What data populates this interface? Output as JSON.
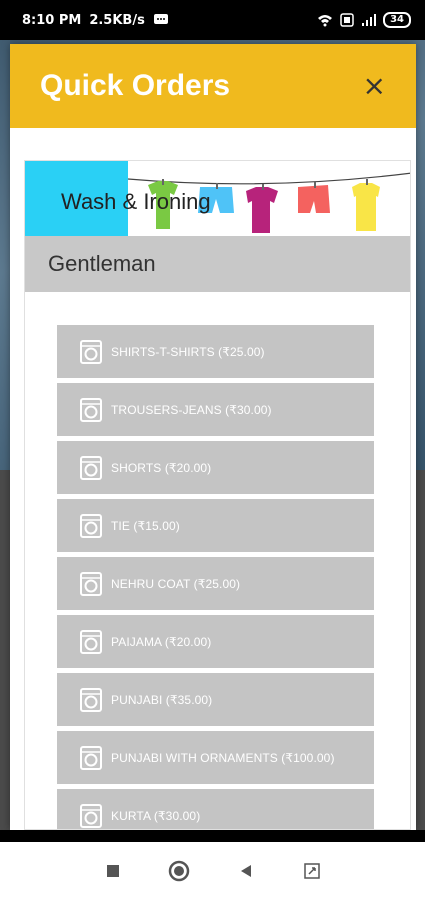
{
  "status_bar": {
    "time": "8:10 PM",
    "speed": "2.5KB/s",
    "battery": "34"
  },
  "modal": {
    "title": "Quick Orders",
    "close_label": "×"
  },
  "banner": {
    "text": "Wash & Ironing"
  },
  "section": {
    "title": "Gentleman"
  },
  "items": [
    {
      "label": "SHIRTS-T-SHIRTS (₹25.00)"
    },
    {
      "label": "TROUSERS-JEANS (₹30.00)"
    },
    {
      "label": "SHORTS (₹20.00)"
    },
    {
      "label": "TIE (₹15.00)"
    },
    {
      "label": "NEHRU COAT (₹25.00)"
    },
    {
      "label": "PAIJAMA (₹20.00)"
    },
    {
      "label": "PUNJABI (₹35.00)"
    },
    {
      "label": "PUNJABI WITH ORNAMENTS (₹100.00)"
    },
    {
      "label": "KURTA (₹30.00)"
    }
  ],
  "colors": {
    "header": "#f0ba1e",
    "banner_accent": "#2ad0f5",
    "item_bg": "#c4c4c4"
  },
  "icons": {
    "item": "washing-machine-icon",
    "nav": [
      "square-recents-icon",
      "circle-home-icon",
      "triangle-back-icon",
      "screen-rotate-icon"
    ]
  }
}
